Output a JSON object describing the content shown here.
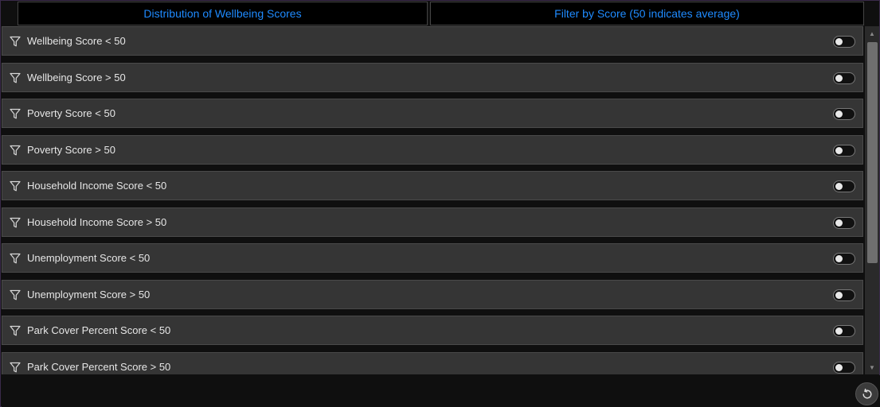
{
  "tabs": [
    {
      "label": "Distribution of Wellbeing Scores"
    },
    {
      "label": "Filter by Score (50 indicates average)"
    }
  ],
  "filters": [
    {
      "label": "Wellbeing Score < 50",
      "enabled": false
    },
    {
      "label": "Wellbeing Score > 50",
      "enabled": false
    },
    {
      "label": "Poverty Score < 50",
      "enabled": false
    },
    {
      "label": "Poverty Score > 50",
      "enabled": false
    },
    {
      "label": "Household Income Score < 50",
      "enabled": false
    },
    {
      "label": "Household Income Score > 50",
      "enabled": false
    },
    {
      "label": "Unemployment Score < 50",
      "enabled": false
    },
    {
      "label": "Unemployment Score > 50",
      "enabled": false
    },
    {
      "label": "Park Cover Percent Score < 50",
      "enabled": false
    },
    {
      "label": "Park Cover Percent Score > 50",
      "enabled": false
    }
  ],
  "icons": {
    "filter": "filter-icon",
    "reset": "reset-icon",
    "scroll_up": "scroll-up-arrow",
    "scroll_down": "scroll-down-arrow"
  },
  "colors": {
    "tab_text": "#1f8bff",
    "row_background": "#353535",
    "page_background": "#000000"
  }
}
